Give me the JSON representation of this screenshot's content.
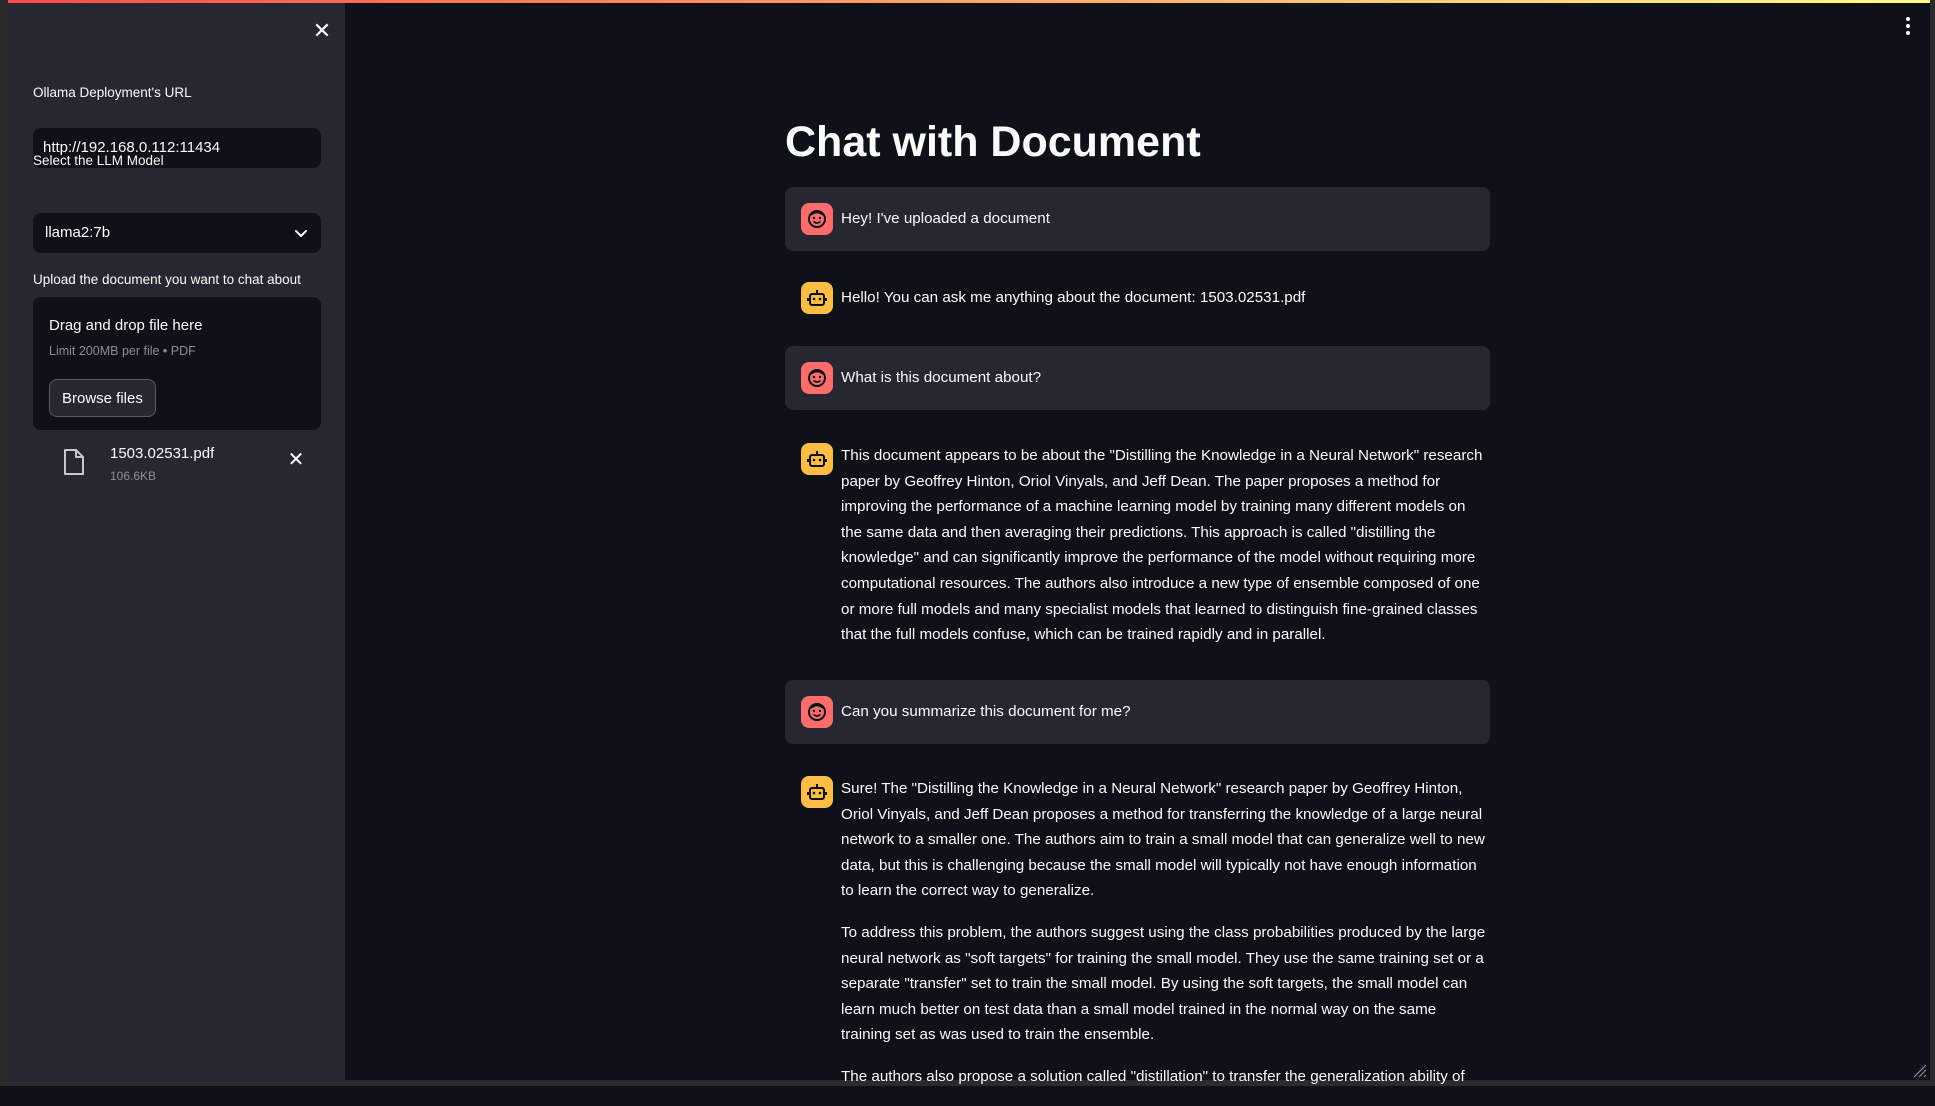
{
  "sidebar": {
    "url_label": "Ollama Deployment's URL",
    "url_value": "http://192.168.0.112:11434",
    "model_label": "Select the LLM Model",
    "model_value": "llama2:7b",
    "upload_label": "Upload the document you want to chat about",
    "dropzone_title": "Drag and drop file here",
    "dropzone_limit": "Limit 200MB per file • PDF",
    "browse_label": "Browse files",
    "file": {
      "name": "1503.02531.pdf",
      "size": "106.6KB"
    }
  },
  "main": {
    "title": "Chat with Document",
    "messages": [
      {
        "role": "user",
        "text": "Hey! I've uploaded a document"
      },
      {
        "role": "assistant",
        "text": "Hello! You can ask me anything about the document: 1503.02531.pdf"
      },
      {
        "role": "user",
        "text": "What is this document about?"
      },
      {
        "role": "assistant",
        "paragraphs": [
          "This document appears to be about the \"Distilling the Knowledge in a Neural Network\" research paper by Geoffrey Hinton, Oriol Vinyals, and Jeff Dean. The paper proposes a method for improving the performance of a machine learning model by training many different models on the same data and then averaging their predictions. This approach is called \"distilling the knowledge\" and can significantly improve the performance of the model without requiring more computational resources. The authors also introduce a new type of ensemble composed of one or more full models and many specialist models that learned to distinguish fine-grained classes that the full models confuse, which can be trained rapidly and in parallel."
        ]
      },
      {
        "role": "user",
        "text": "Can you summarize this document for me?"
      },
      {
        "role": "assistant",
        "paragraphs": [
          "Sure! The \"Distilling the Knowledge in a Neural Network\" research paper by Geoffrey Hinton, Oriol Vinyals, and Jeff Dean proposes a method for transferring the knowledge of a large neural network to a smaller one. The authors aim to train a small model that can generalize well to new data, but this is challenging because the small model will typically not have enough information to learn the correct way to generalize.",
          "To address this problem, the authors suggest using the class probabilities produced by the large neural network as \"soft targets\" for training the small model. They use the same training set or a separate \"transfer\" set to train the small model. By using the soft targets, the small model can learn much better on test data than a small model trained in the normal way on the same training set as was used to train the ensemble.",
          "The authors also propose a solution called \"distillation\" to transfer the generalization ability of"
        ]
      }
    ]
  },
  "colors": {
    "background": "#0e1117",
    "sidebar": "#262730",
    "user_avatar": "#ff6c6c",
    "bot_avatar": "#ffbd45"
  },
  "icons": {
    "close": "close-icon",
    "chevron": "chevron-down-icon",
    "file": "file-icon",
    "menu": "kebab-menu-icon",
    "user_avatar": "face-icon",
    "bot_avatar": "robot-icon"
  }
}
